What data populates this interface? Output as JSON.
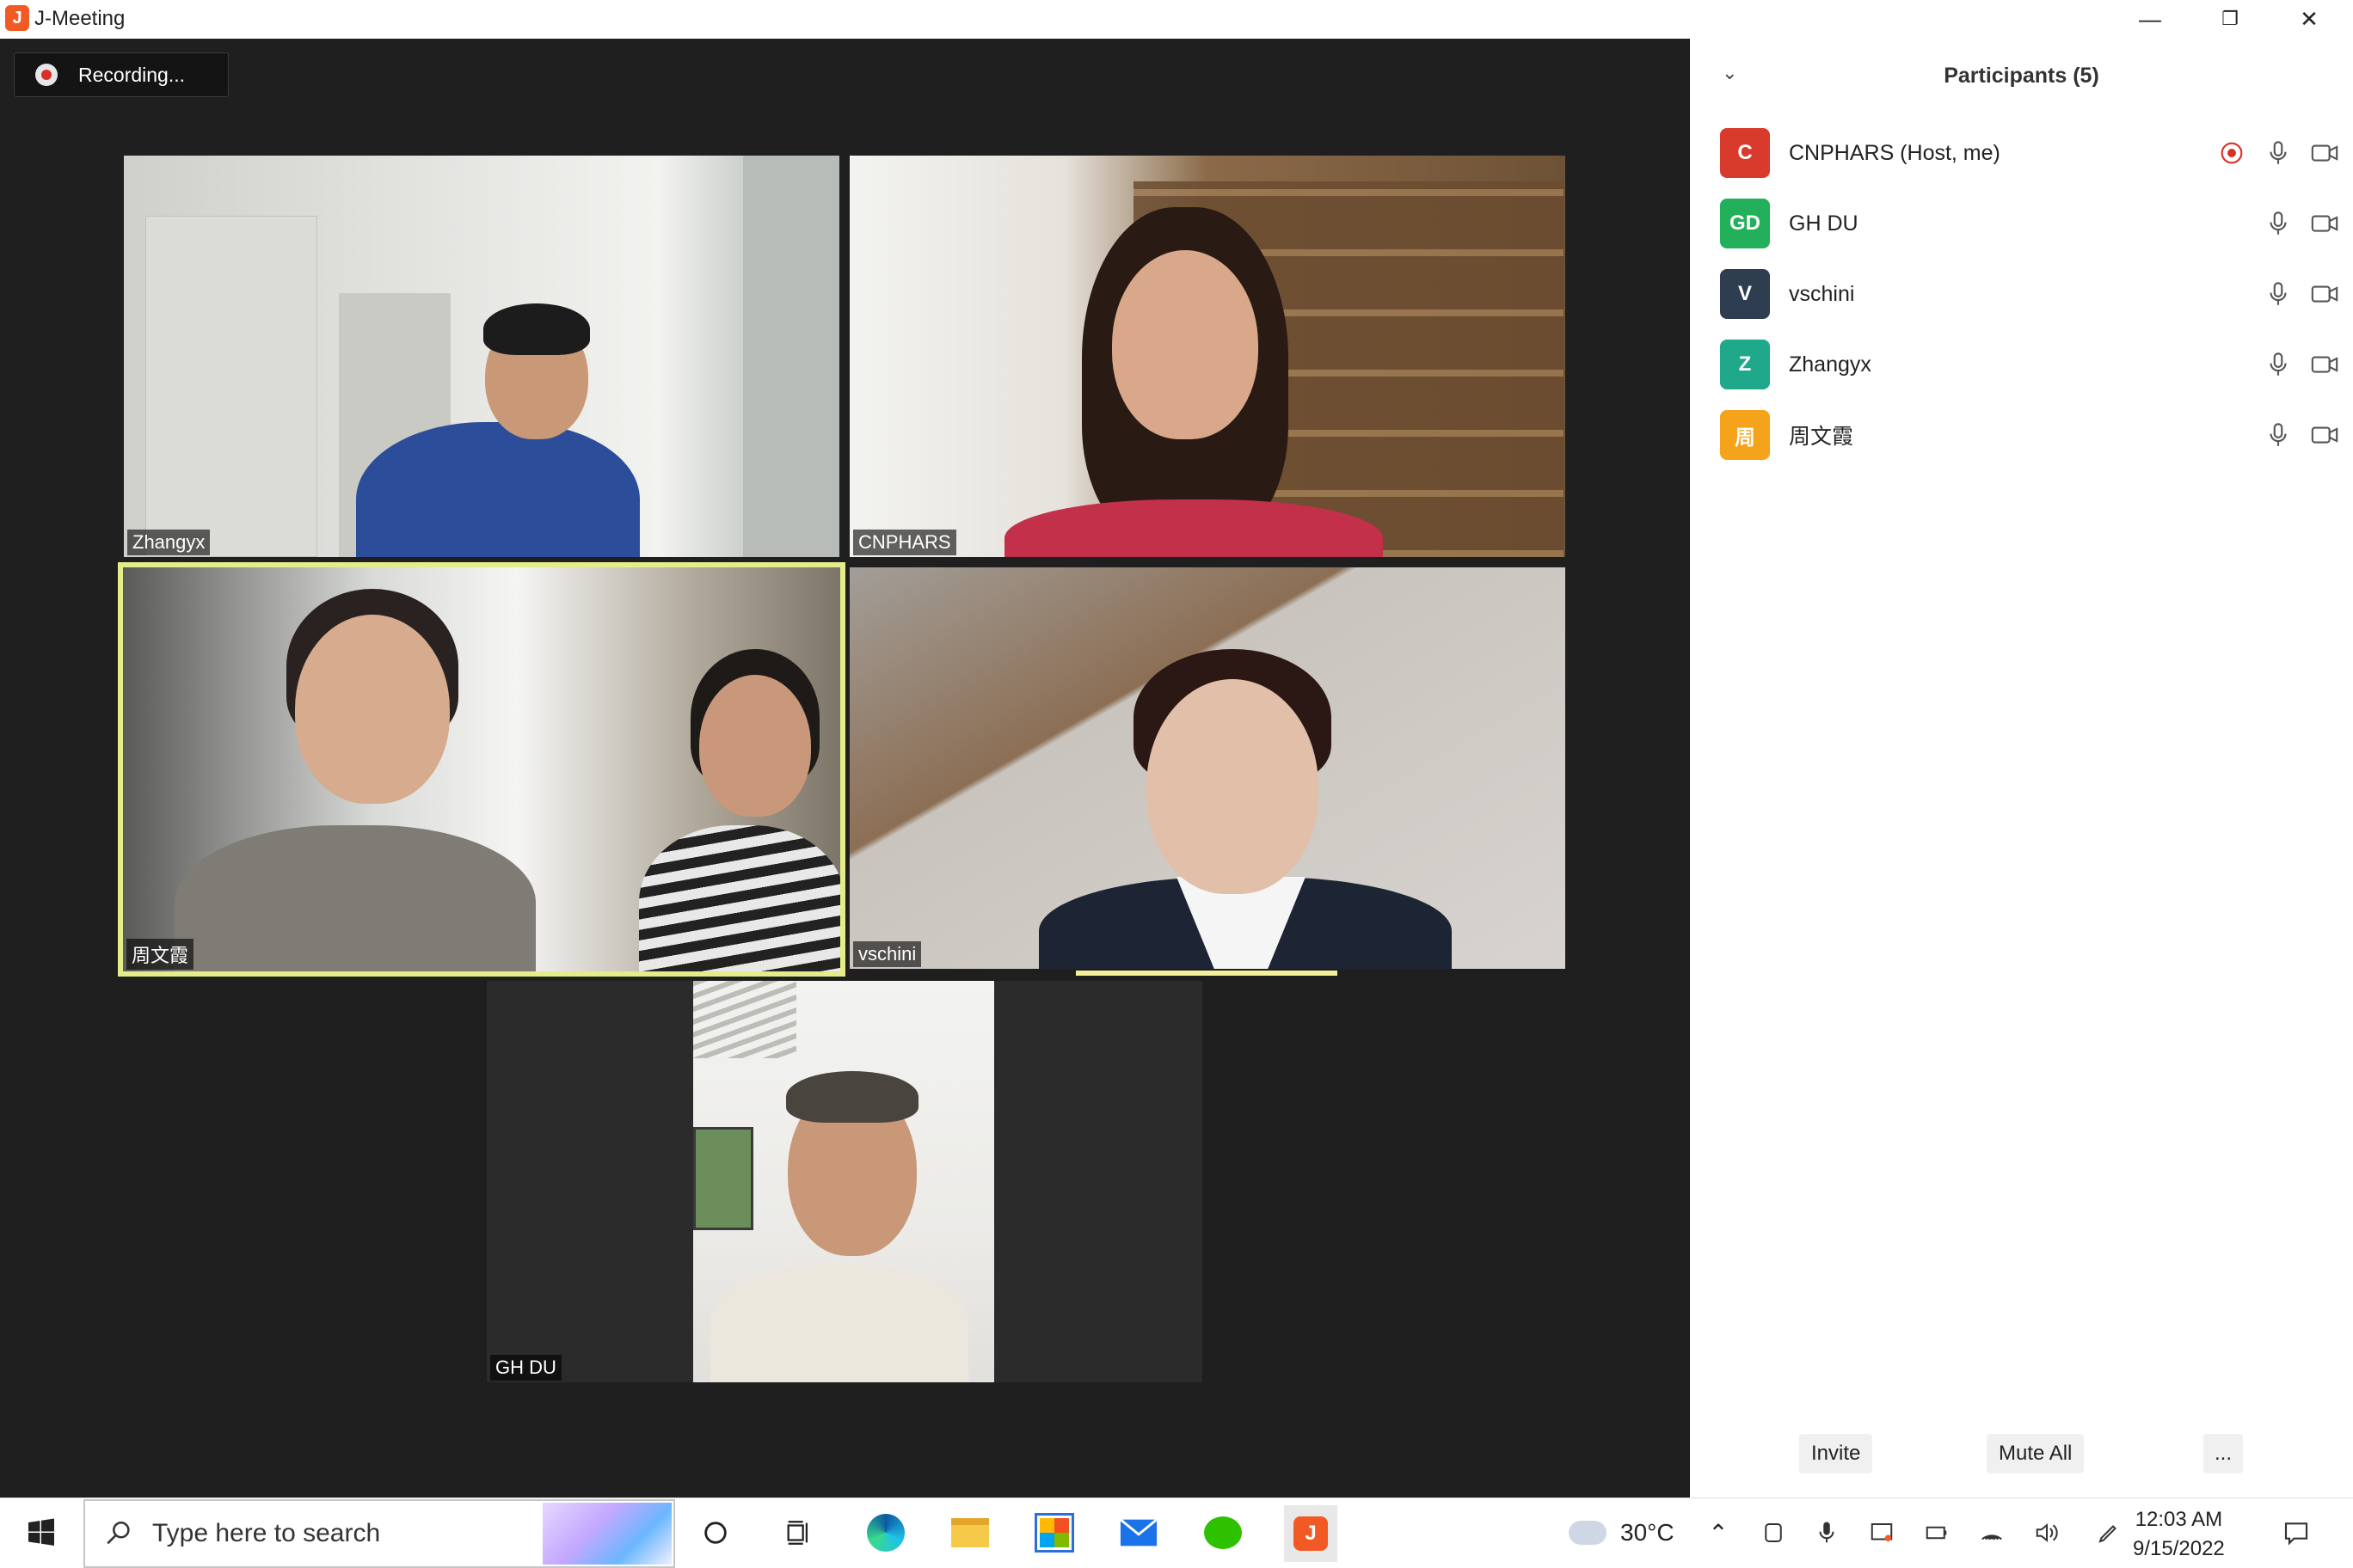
{
  "app": {
    "title": "J-Meeting",
    "logo_letter": "J"
  },
  "recording": {
    "label": "Recording..."
  },
  "tiles": [
    {
      "name": "Zhangyx"
    },
    {
      "name": "CNPHARS"
    },
    {
      "name": "周文霞"
    },
    {
      "name": "vschini"
    },
    {
      "name": "GH DU"
    }
  ],
  "window_controls": {
    "minimize": "—",
    "restore": "❐",
    "close": "✕"
  },
  "participants": {
    "title": "Participants (5)",
    "items": [
      {
        "initials": "C",
        "name": "CNPHARS (Host, me)",
        "color": "#d83b2c"
      },
      {
        "initials": "GD",
        "name": "GH DU",
        "color": "#22b05a"
      },
      {
        "initials": "V",
        "name": "vschini",
        "color": "#2e3d50"
      },
      {
        "initials": "Z",
        "name": "Zhangyx",
        "color": "#1fa98a"
      },
      {
        "initials": "周",
        "name": "周文霞",
        "color": "#f5a31a"
      }
    ],
    "buttons": {
      "invite": "Invite",
      "mute_all": "Mute All",
      "more": "..."
    }
  },
  "taskbar": {
    "search_placeholder": "Type here to search",
    "weather": "30°C",
    "time": "12:03 AM",
    "date": "9/15/2022"
  },
  "colors": {
    "accent_speaker": "#f4f09a",
    "app_orange": "#f15a24"
  }
}
